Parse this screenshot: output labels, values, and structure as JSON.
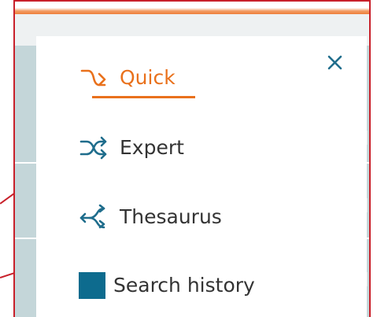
{
  "search_menu": {
    "items": [
      {
        "label": "Quick",
        "icon": "quick-arrow-icon",
        "active": true
      },
      {
        "label": "Expert",
        "icon": "shuffle-arrows-icon",
        "active": false
      },
      {
        "label": "Thesaurus",
        "icon": "merge-arrows-icon",
        "active": false
      },
      {
        "label": "Search history",
        "icon": "square-icon",
        "active": false
      }
    ],
    "close_icon": "close-icon"
  },
  "colors": {
    "active": "#e9711c",
    "icon": "#1f6d8c",
    "text": "#333333",
    "frame": "#c8202a",
    "square": "#0d6b8e"
  }
}
